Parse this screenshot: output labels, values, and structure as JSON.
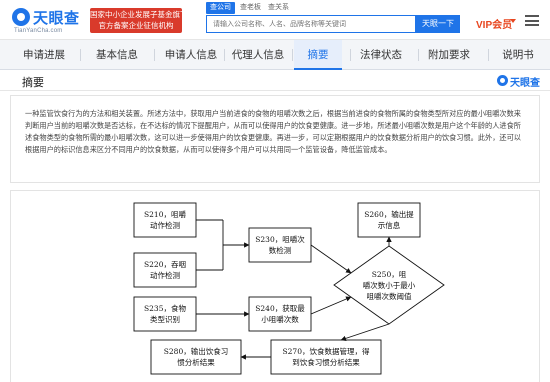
{
  "header": {
    "logo_text": "天眼查",
    "logo_sub": "TianYanCha.com",
    "badge_line1": "国家中小企业发展子基金旗下",
    "badge_line2": "官方备案企业征信机构",
    "search_tabs": [
      "查公司",
      "查老板",
      "查关系"
    ],
    "search_placeholder": "请输入公司名称、人名、品牌名称等关键词",
    "search_button": "天眼一下",
    "vip_label": "VIP会员",
    "accent_color": "#1f74e8",
    "brand_red": "#d93a2b",
    "vip_color": "#e8461f"
  },
  "nav": {
    "tabs": [
      "申请进展",
      "基本信息",
      "申请人信息",
      "代理人信息",
      "摘要",
      "法律状态",
      "附加要求",
      "说明书"
    ],
    "active": "摘要"
  },
  "section": {
    "title": "摘要",
    "watermark": "天眼查"
  },
  "abstract": {
    "text": "一种监管饮食行为的方法和相关装置。所述方法中，获取用户当前进食的食物的咀嚼次数之后，根据当前进食的食物所属的食物类型所对应的最小咀嚼次数来判断用户当前的咀嚼次数是否达标，在不达标的情况下提醒用户，从而可以使得用户的饮食更健康。进一步地，所述最小咀嚼次数是用户这个年龄的人进食所述食物类型的食物所需的最小咀嚼次数，这可以进一步使得用户的饮食更健康。再进一步，可以定期根据用户的饮食数据分析用户的饮食习惯。此外，还可以根据用户的标识信息来区分不同用户的饮食数据，从而可以使得多个用户可以共用同一个监管设备，降低监管成本。"
  },
  "figure": {
    "boxes": {
      "s210": [
        "S210，咀嚼",
        "动作检测"
      ],
      "s220": [
        "S220，吞咽",
        "动作检测"
      ],
      "s230": [
        "S230，咀嚼次",
        "数检测"
      ],
      "s235": [
        "S235，食物",
        "类型识别"
      ],
      "s240": [
        "S240，获取最",
        "小咀嚼次数"
      ],
      "s250": [
        "S250，咀",
        "嚼次数小于最小",
        "咀嚼次数阈值"
      ],
      "s260": [
        "S260，输出提",
        "示信息"
      ],
      "s270": [
        "S270，饮食数据管理，得",
        "到饮食习惯分析结果"
      ],
      "s280": [
        "S280，输出饮食习",
        "惯分析结果"
      ]
    }
  }
}
